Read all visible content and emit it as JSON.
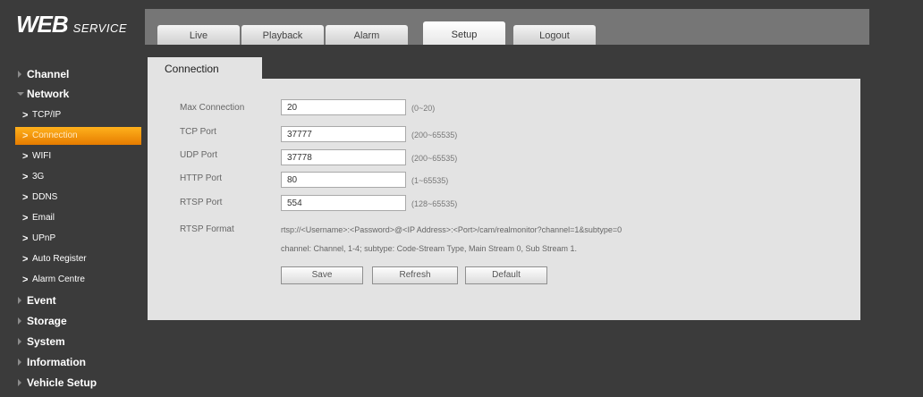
{
  "logo": {
    "main": "WEB",
    "sub": "SERVICE"
  },
  "tabs": [
    "Live",
    "Playback",
    "Alarm",
    "Setup",
    "Logout"
  ],
  "sidebar": {
    "channel": "Channel",
    "network": "Network",
    "network_items": [
      "TCP/IP",
      "Connection",
      "WIFI",
      "3G",
      "DDNS",
      "Email",
      "UPnP",
      "Auto Register",
      "Alarm Centre"
    ],
    "event": "Event",
    "storage": "Storage",
    "system": "System",
    "information": "Information",
    "vehicle_setup": "Vehicle Setup"
  },
  "content": {
    "tab_title": "Connection",
    "max_connection": {
      "label": "Max Connection",
      "value": "20",
      "hint": "(0~20)"
    },
    "tcp_port": {
      "label": "TCP Port",
      "value": "37777",
      "hint": "(200~65535)"
    },
    "udp_port": {
      "label": "UDP Port",
      "value": "37778",
      "hint": "(200~65535)"
    },
    "http_port": {
      "label": "HTTP Port",
      "value": "80",
      "hint": "(1~65535)"
    },
    "rtsp_port": {
      "label": "RTSP Port",
      "value": "554",
      "hint": "(128~65535)"
    },
    "rtsp_format": {
      "label": "RTSP Format",
      "value": "rtsp://<Username>:<Password>@<IP Address>:<Port>/cam/realmonitor?channel=1&subtype=0",
      "note": "channel: Channel, 1-4; subtype: Code-Stream Type, Main Stream 0, Sub Stream 1."
    },
    "buttons": {
      "save": "Save",
      "refresh": "Refresh",
      "default": "Default"
    }
  },
  "colors": {
    "background": "#3b3b3b",
    "active_orange": "#f59a0c",
    "panel": "#e3e3e3"
  }
}
